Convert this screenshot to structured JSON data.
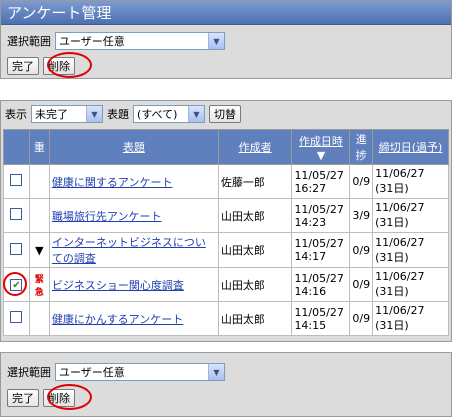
{
  "header": {
    "title": "アンケート管理"
  },
  "scope": {
    "label": "選択範囲",
    "value": "ユーザー任意"
  },
  "actions": {
    "done": "完了",
    "delete": "削除"
  },
  "filter": {
    "show_label": "表示",
    "show_value": "未完了",
    "subject_label": "表題",
    "subject_value": "(すべて)",
    "switch": "切替"
  },
  "table": {
    "headers": {
      "important": "重",
      "subject": "表題",
      "author": "作成者",
      "created": "作成日時",
      "sort_mark": "▼",
      "progress": "進捗",
      "deadline": "締切日(過予)"
    },
    "rows": [
      {
        "checked": false,
        "mark": "",
        "subject": "健康に関するアンケート",
        "author": "佐藤一郎",
        "created_date": "11/05/27",
        "created_time": "16:27",
        "progress": "0/9",
        "deadline_date": "11/06/27",
        "deadline_note": "(31日)"
      },
      {
        "checked": false,
        "mark": "",
        "subject": "職場旅行先アンケート",
        "author": "山田太郎",
        "created_date": "11/05/27",
        "created_time": "14:23",
        "progress": "3/9",
        "deadline_date": "11/06/27",
        "deadline_note": "(31日)"
      },
      {
        "checked": false,
        "mark": "▼",
        "subject": "インターネットビジネスについての調査",
        "author": "山田太郎",
        "created_date": "11/05/27",
        "created_time": "14:17",
        "progress": "0/9",
        "deadline_date": "11/06/27",
        "deadline_note": "(31日)"
      },
      {
        "checked": true,
        "mark": "緊急",
        "subject": "ビジネスショー関心度調査",
        "author": "山田太郎",
        "created_date": "11/05/27",
        "created_time": "14:16",
        "progress": "0/9",
        "deadline_date": "11/06/27",
        "deadline_note": "(31日)"
      },
      {
        "checked": false,
        "mark": "",
        "subject": "健康にかんするアンケート",
        "author": "山田太郎",
        "created_date": "11/05/27",
        "created_time": "14:15",
        "progress": "0/9",
        "deadline_date": "11/06/27",
        "deadline_note": "(31日)"
      }
    ]
  },
  "icons": {
    "dropdown": "dropdown-arrow-icon",
    "checkmark": "checkmark-icon"
  },
  "colors": {
    "title_bar": "#4c6fb0",
    "header": "#5f7fbd",
    "highlight": "#e00000",
    "link": "#1f3fb0"
  }
}
